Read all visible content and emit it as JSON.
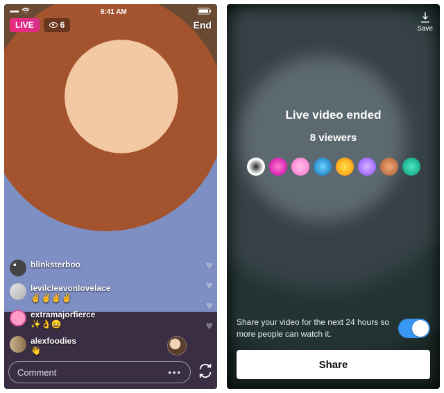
{
  "live": {
    "status_bar": {
      "signal": "•••••",
      "time": "9:41 AM",
      "battery": "100%"
    },
    "badge_label": "LIVE",
    "viewer_count": "6",
    "end_label": "End",
    "comment_placeholder": "Comment",
    "comments": [
      {
        "user": "blinksterboo",
        "text": ""
      },
      {
        "user": "levilcleavonlovelace",
        "text": "✌️✌️✌️✌️"
      },
      {
        "user": "extramajorfierce",
        "text": "✨👌😄"
      },
      {
        "user": "alexfoodies",
        "text": "👋"
      }
    ]
  },
  "ended": {
    "save_label": "Save",
    "title": "Live video ended",
    "viewers_line": "8 viewers",
    "share_message": "Share your video for the next 24 hours so more people can watch it.",
    "share_button": "Share"
  }
}
